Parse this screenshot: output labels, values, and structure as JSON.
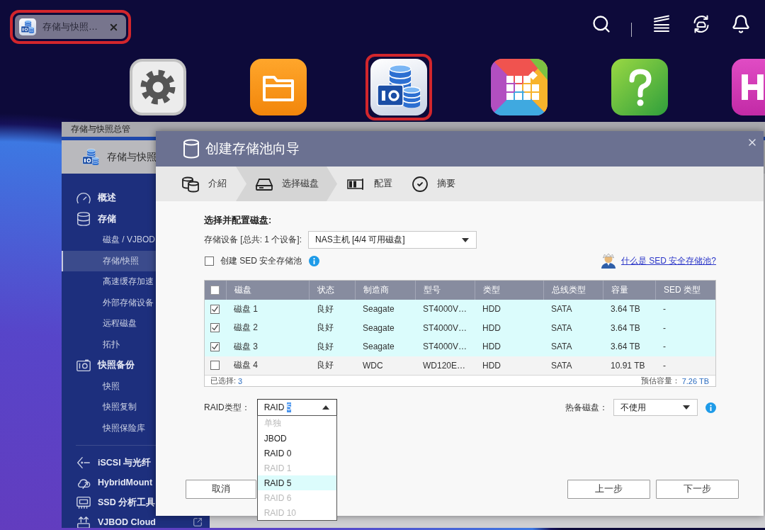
{
  "taskbar": {
    "tab": {
      "title": "存储与快照…",
      "highlighted": true
    }
  },
  "desktop_apps": [
    {
      "kind": "settings",
      "highlighted": false
    },
    {
      "kind": "files",
      "highlighted": false
    },
    {
      "kind": "storage",
      "highlighted": true
    },
    {
      "kind": "apps",
      "highlighted": false
    },
    {
      "kind": "help",
      "highlighted": false
    },
    {
      "kind": "hdmi",
      "highlighted": false
    }
  ],
  "app_window": {
    "title": "存储与快照总管",
    "header_title": "存储与快照",
    "sidebar": {
      "sections": [
        {
          "items": [
            {
              "label": "概述",
              "kind": "gauge",
              "selected": false
            },
            {
              "label": "存储",
              "kind": "database",
              "selected": false,
              "children": [
                {
                  "label": "磁盘 / VJBOD",
                  "selected": false
                },
                {
                  "label": "存储/快照",
                  "selected": true
                },
                {
                  "label": "高速缓存加速",
                  "selected": false
                },
                {
                  "label": "外部存储设备",
                  "selected": false
                },
                {
                  "label": "远程磁盘",
                  "selected": false
                },
                {
                  "label": "拓扑",
                  "selected": false
                }
              ]
            },
            {
              "label": "快照备份",
              "kind": "snapshot",
              "selected": false,
              "children": [
                {
                  "label": "快照",
                  "selected": false
                },
                {
                  "label": "快照复制",
                  "selected": false
                },
                {
                  "label": "快照保险库",
                  "selected": false
                }
              ]
            }
          ]
        },
        {
          "items": [
            {
              "label": "iSCSI 与光纤",
              "kind": "iscsi",
              "selected": false
            },
            {
              "label": "HybridMount",
              "kind": "hybridmount",
              "selected": false
            },
            {
              "label": "SSD 分析工具",
              "kind": "ssd",
              "selected": false
            },
            {
              "label": "VJBOD Cloud",
              "kind": "vjbod_cloud",
              "selected": false,
              "external": true
            }
          ]
        }
      ]
    }
  },
  "dialog": {
    "title": "创建存储池向导",
    "steps": [
      {
        "label": "介紹",
        "kind": "intro",
        "selected": false
      },
      {
        "label": "选择磁盘",
        "kind": "disks",
        "selected": true
      },
      {
        "label": "配置",
        "kind": "configure",
        "selected": false
      },
      {
        "label": "摘要",
        "kind": "summary",
        "selected": false
      }
    ],
    "section_title": "选择并配置磁盘:",
    "device": {
      "label": "存储设备 [总共: 1 个设备]:",
      "value": "NAS主机 [4/4 可用磁盘]"
    },
    "sed_option": {
      "label": "创建 SED 安全存储池",
      "checked": false
    },
    "help_link": "什么是 SED 安全存储池?",
    "disk_table": {
      "all_checked": false,
      "columns": [
        "磁盘",
        "状态",
        "制造商",
        "型号",
        "类型",
        "总线类型",
        "容量",
        "SED 类型"
      ],
      "rows": [
        {
          "selected": true,
          "cells": [
            "磁盘 1",
            "良好",
            "Seagate",
            "ST4000V…",
            "HDD",
            "SATA",
            "3.64 TB",
            "-"
          ]
        },
        {
          "selected": true,
          "cells": [
            "磁盘 2",
            "良好",
            "Seagate",
            "ST4000V…",
            "HDD",
            "SATA",
            "3.64 TB",
            "-"
          ]
        },
        {
          "selected": true,
          "cells": [
            "磁盘 3",
            "良好",
            "Seagate",
            "ST4000V…",
            "HDD",
            "SATA",
            "3.64 TB",
            "-"
          ]
        },
        {
          "selected": false,
          "cells": [
            "磁盘 4",
            "良好",
            "WDC",
            "WD120E…",
            "HDD",
            "SATA",
            "10.91 TB",
            "-"
          ]
        }
      ],
      "footer": {
        "selected_label": "已选择:",
        "selected_count": "3",
        "capacity_label": "预估容量：",
        "capacity_value": "7.26 TB"
      }
    },
    "raid_type": {
      "label": "RAID类型：",
      "value": "RAID",
      "highlighted_text": "5",
      "expanded": true,
      "options": [
        {
          "label": "单独",
          "disabled": true,
          "selected": false
        },
        {
          "label": "JBOD",
          "disabled": false,
          "selected": false
        },
        {
          "label": "RAID 0",
          "disabled": false,
          "selected": false
        },
        {
          "label": "RAID 1",
          "disabled": true,
          "selected": false
        },
        {
          "label": "RAID 5",
          "disabled": false,
          "selected": true
        },
        {
          "label": "RAID 6",
          "disabled": true,
          "selected": false
        },
        {
          "label": "RAID 10",
          "disabled": true,
          "selected": false
        }
      ]
    },
    "hot_spare": {
      "label": "热备磁盘：",
      "value": "不使用"
    },
    "buttons": [
      {
        "label": "取消",
        "kind": "cancel"
      },
      {
        "label": "上一步",
        "kind": "back"
      },
      {
        "label": "下一步",
        "kind": "next"
      }
    ]
  }
}
